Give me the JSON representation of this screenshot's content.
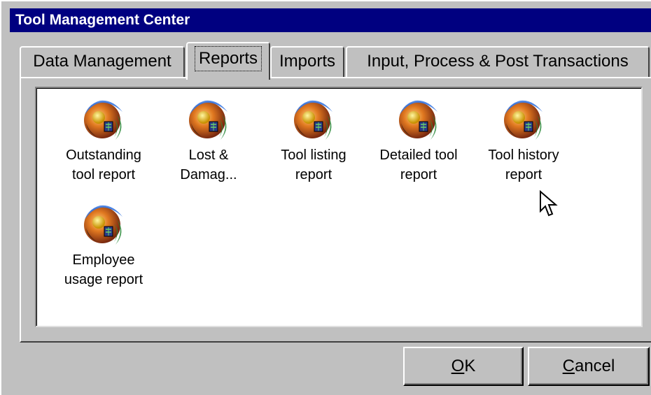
{
  "window": {
    "title": "Tool Management Center"
  },
  "tabs": [
    {
      "label": "Data Management",
      "active": false
    },
    {
      "label": "Reports",
      "active": true
    },
    {
      "label": "Imports",
      "active": false
    },
    {
      "label": "Input, Process & Post Transactions",
      "active": false
    }
  ],
  "reports": [
    {
      "label": "Outstanding\ntool report",
      "icon": "report-globe-icon"
    },
    {
      "label": "Lost &\nDamag...",
      "icon": "report-globe-icon"
    },
    {
      "label": "Tool listing\nreport",
      "icon": "report-globe-icon"
    },
    {
      "label": "Detailed tool\nreport",
      "icon": "report-globe-icon"
    },
    {
      "label": "Tool history\nreport",
      "icon": "report-globe-icon"
    },
    {
      "label": "Employee\nusage report",
      "icon": "report-globe-icon"
    }
  ],
  "buttons": {
    "ok": {
      "mnemonic": "O",
      "rest": "K"
    },
    "cancel": {
      "mnemonic": "C",
      "rest": "ancel"
    }
  },
  "colors": {
    "title_bar": "#000080",
    "face": "#c0c0c0",
    "list_bg": "#ffffff"
  }
}
